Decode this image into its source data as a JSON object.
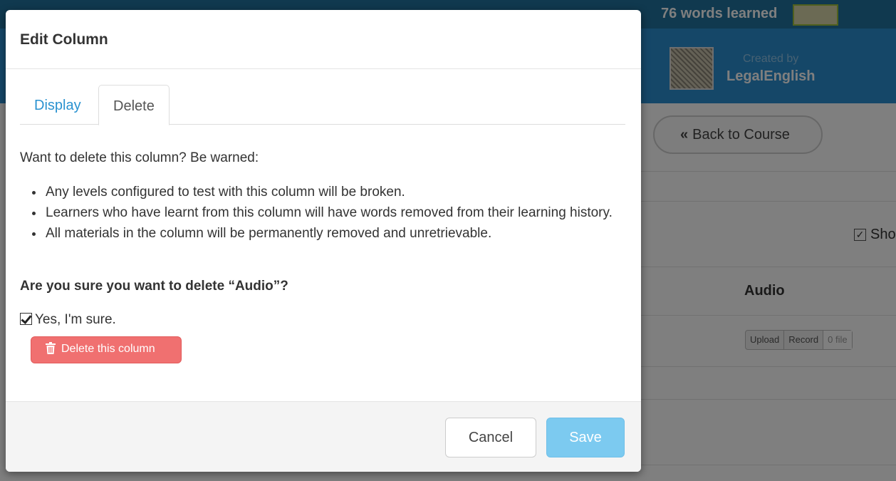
{
  "background": {
    "words_learned": "76 words learned",
    "created_by_label": "Created by",
    "author": "LegalEnglish",
    "back_to_course": "Back to Course",
    "show_label": "Sho",
    "audio_header": "Audio",
    "upload_label": "Upload",
    "record_label": "Record",
    "files_label": "0 file"
  },
  "modal": {
    "title": "Edit Column",
    "tabs": [
      {
        "label": "Display",
        "active": false
      },
      {
        "label": "Delete",
        "active": true
      }
    ],
    "warning_intro": "Want to delete this column? Be warned:",
    "warnings": [
      "Any levels configured to test with this column will be broken.",
      "Learners who have learnt from this column will have words removed from their learning history.",
      "All materials in the column will be permanently removed and unretrievable."
    ],
    "confirm_question": "Are you sure you want to delete “Audio”?",
    "confirm_checkbox_label": "Yes, I'm sure.",
    "confirm_checked": true,
    "delete_button": "Delete this column",
    "cancel_button": "Cancel",
    "save_button": "Save"
  },
  "colors": {
    "accent": "#2a92d0",
    "danger": "#f07070",
    "save_disabled": "#7ccaf0",
    "header_blue": "#2b8fd0"
  }
}
